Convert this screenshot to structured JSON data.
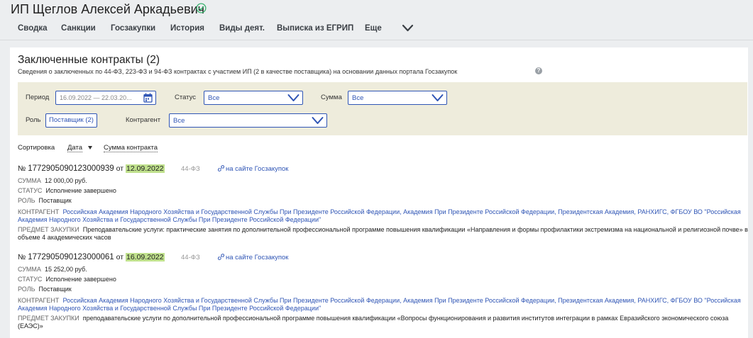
{
  "header": {
    "title": "ИП Щеглов Алексей Аркадьевич",
    "tabs": [
      "Сводка",
      "Санкции",
      "Госзакупки",
      "История",
      "Виды деят.",
      "Выписка из ЕГРИП",
      "Еще"
    ]
  },
  "section": {
    "title": "Заключенные контракты (2)",
    "subtitle": "Сведения о заключенных по 44-ФЗ, 223-ФЗ и 94-ФЗ контрактах с участием ИП (2 в качестве поставщика) на основании данных портала Госзакупок",
    "help": "?"
  },
  "filters": {
    "period_label": "Период",
    "period_value": "16.09.2022 — 22.03.20...",
    "status_label": "Статус",
    "status_value": "Все",
    "sum_label": "Сумма",
    "sum_value": "Все",
    "role_label": "Роль",
    "role_value": "Поставщик (2)",
    "counterparty_label": "Контрагент",
    "counterparty_value": "Все"
  },
  "sort": {
    "label": "Сортировка",
    "date": "Дата",
    "sum": "Сумма контракта"
  },
  "contracts": [
    {
      "number_prefix": "№ ",
      "number": "1772905090123000939",
      "date_prefix": " от ",
      "date": "12.09.2022",
      "law": "44-ФЗ",
      "link": "на сайте Госзакупок",
      "sum_key": "СУММА",
      "sum": "12 000,00 руб.",
      "status_key": "СТАТУС",
      "status": "Исполнение завершено",
      "role_key": "РОЛЬ",
      "role": "Поставщик",
      "counterparty_key": "КОНТРАГЕНТ",
      "counterparty": "Российская Академия Народного Хозяйства и Государственной Службы При Президенте Российской Федерации, Академия При Президенте Российской Федерации, Президентская Академия, РАНХИГС, ФГБОУ ВО \"Российская Академия Народного Хозяйства и Государственной Службы При Президенте Российской Федерации\"",
      "subject_key": "ПРЕДМЕТ ЗАКУПКИ",
      "subject": "Преподавательские услуги: практические занятия по дополнительной профессиональной программе повышения квалификации «Направления и формы профилактики экстремизма на национальной и религиозной почве» в объеме 4 академических часов"
    },
    {
      "number_prefix": "№ ",
      "number": "1772905090123000061",
      "date_prefix": " от ",
      "date": "16.09.2022",
      "law": "44-ФЗ",
      "link": "на сайте Госзакупок",
      "sum_key": "СУММА",
      "sum": "15 252,00 руб.",
      "status_key": "СТАТУС",
      "status": "Исполнение завершено",
      "role_key": "РОЛЬ",
      "role": "Поставщик",
      "counterparty_key": "КОНТРАГЕНТ",
      "counterparty": "Российская Академия Народного Хозяйства и Государственной Службы При Президенте Российской Федерации, Академия При Президенте Российской Федерации, Президентская Академия, РАНХИГС, ФГБОУ ВО \"Российская Академия Народного Хозяйства и Государственной Службы При Президенте Российской Федерации\"",
      "subject_key": "ПРЕДМЕТ ЗАКУПКИ",
      "subject": "преподавательские услуги по дополнительной профессиональной программе повышения квалификации «Вопросы функционирования и развития институтов интеграции в рамках Евразийского экономического союза (ЕАЭС)»"
    }
  ],
  "colors": {
    "accent": "#2f55b5",
    "date_highlight": "#bfe08c",
    "filter_bg": "#eeecdc",
    "verified": "#3cb371"
  }
}
